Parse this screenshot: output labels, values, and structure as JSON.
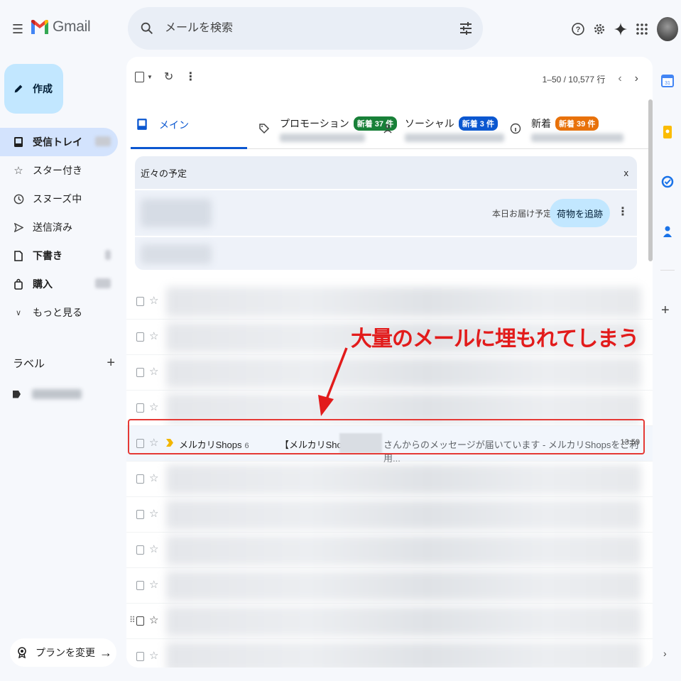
{
  "header": {
    "app_name": "Gmail",
    "search_placeholder": "メールを検索"
  },
  "sidebar": {
    "compose_label": "作成",
    "items": [
      {
        "label": "受信トレイ",
        "icon": "inbox-icon",
        "active": true
      },
      {
        "label": "スター付き",
        "icon": "star-icon"
      },
      {
        "label": "スヌーズ中",
        "icon": "clock-icon"
      },
      {
        "label": "送信済み",
        "icon": "send-icon"
      },
      {
        "label": "下書き",
        "icon": "draft-icon"
      },
      {
        "label": "購入",
        "icon": "shopping-bag-icon"
      },
      {
        "label": "もっと見る",
        "icon": "chevron-down-icon"
      }
    ],
    "labels_heading": "ラベル",
    "plan_label": "プランを変更"
  },
  "toolbar": {
    "pagination": "1–50 / 10,577 行"
  },
  "tabs": [
    {
      "label": "メイン",
      "active": true
    },
    {
      "label": "プロモーション",
      "badge": "新着 37 件",
      "badge_color": "#188038"
    },
    {
      "label": "ソーシャル",
      "badge": "新着 3 件",
      "badge_color": "#0b57d0"
    },
    {
      "label": "新着",
      "badge": "新着 39 件",
      "badge_color": "#e8710a"
    }
  ],
  "upcoming": {
    "title": "近々の予定",
    "close": "x",
    "delivery_text": "本日お届け予定",
    "track_button": "荷物を追跡"
  },
  "highlighted_email": {
    "sender": "メルカリShops",
    "count": "6",
    "subject": "【メルカリShops】",
    "snippet": "さんからのメッセージが届いています - メルカリShopsをご利用...",
    "time": "13:59"
  },
  "annotation": {
    "text": "大量のメールに埋もれてしまう",
    "color": "#e21b1b"
  },
  "colors": {
    "accent": "#0b57d0",
    "compose_bg": "#c2e7ff",
    "active_nav_bg": "#d3e3fd",
    "highlight_border": "#e53935"
  }
}
